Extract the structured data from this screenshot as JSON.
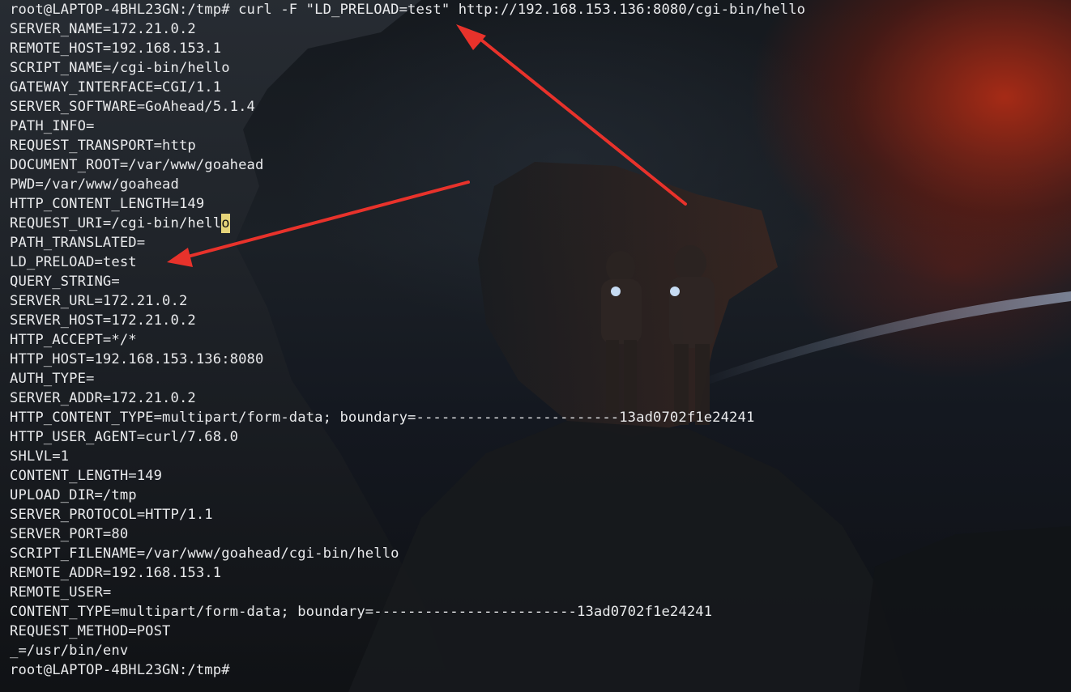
{
  "terminal": {
    "colors": {
      "text": "#e9eaec",
      "cursor": "#e6d47a",
      "annotation_arrow": "#e8322b",
      "glow": "#be2d14"
    },
    "lines": [
      {
        "text": "root@LAPTOP-4BHL23GN:/tmp# curl -F \"LD_PRELOAD=test\" http://192.168.153.136:8080/cgi-bin/hello"
      },
      {
        "text": "SERVER_NAME=172.21.0.2"
      },
      {
        "text": "REMOTE_HOST=192.168.153.1"
      },
      {
        "text": "SCRIPT_NAME=/cgi-bin/hello"
      },
      {
        "text": "GATEWAY_INTERFACE=CGI/1.1"
      },
      {
        "text": "SERVER_SOFTWARE=GoAhead/5.1.4"
      },
      {
        "text": "PATH_INFO="
      },
      {
        "text": "REQUEST_TRANSPORT=http"
      },
      {
        "text": "DOCUMENT_ROOT=/var/www/goahead"
      },
      {
        "text": "PWD=/var/www/goahead"
      },
      {
        "text": "HTTP_CONTENT_LENGTH=149"
      },
      {
        "text": "REQUEST_URI=/cgi-bin/hell",
        "cursor": "o"
      },
      {
        "text": "PATH_TRANSLATED="
      },
      {
        "text": "LD_PRELOAD=test"
      },
      {
        "text": "QUERY_STRING="
      },
      {
        "text": "SERVER_URL=172.21.0.2"
      },
      {
        "text": "SERVER_HOST=172.21.0.2"
      },
      {
        "text": "HTTP_ACCEPT=*/*"
      },
      {
        "text": "HTTP_HOST=192.168.153.136:8080"
      },
      {
        "text": "AUTH_TYPE="
      },
      {
        "text": "SERVER_ADDR=172.21.0.2"
      },
      {
        "text": "HTTP_CONTENT_TYPE=multipart/form-data; boundary=------------------------13ad0702f1e24241"
      },
      {
        "text": "HTTP_USER_AGENT=curl/7.68.0"
      },
      {
        "text": "SHLVL=1"
      },
      {
        "text": "CONTENT_LENGTH=149"
      },
      {
        "text": "UPLOAD_DIR=/tmp"
      },
      {
        "text": "SERVER_PROTOCOL=HTTP/1.1"
      },
      {
        "text": "SERVER_PORT=80"
      },
      {
        "text": "SCRIPT_FILENAME=/var/www/goahead/cgi-bin/hello"
      },
      {
        "text": "REMOTE_ADDR=192.168.153.1"
      },
      {
        "text": "REMOTE_USER="
      },
      {
        "text": "CONTENT_TYPE=multipart/form-data; boundary=------------------------13ad0702f1e24241"
      },
      {
        "text": "REQUEST_METHOD=POST"
      },
      {
        "text": "_=/usr/bin/env"
      },
      {
        "text": "root@LAPTOP-4BHL23GN:/tmp#"
      }
    ]
  }
}
